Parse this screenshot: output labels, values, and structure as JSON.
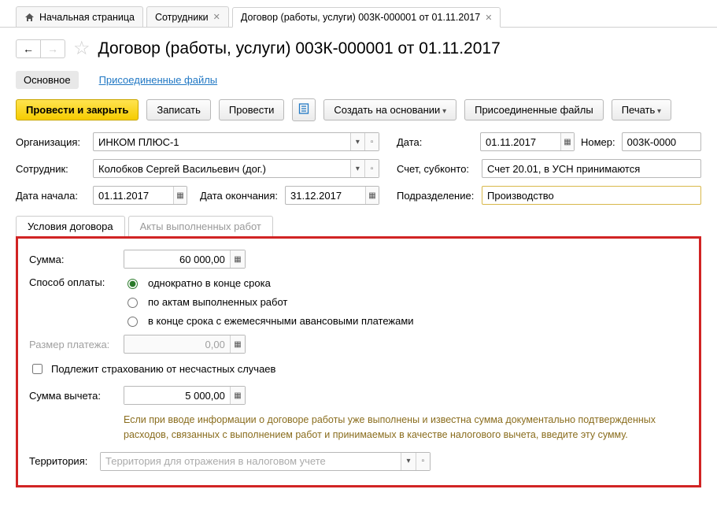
{
  "tabs": {
    "home": "Начальная страница",
    "emp": "Сотрудники",
    "doc": "Договор (работы, услуги) 003К-000001 от 01.11.2017"
  },
  "title": "Договор (работы, услуги) 003К-000001 от 01.11.2017",
  "section": {
    "main": "Основное",
    "files": "Присоединенные файлы"
  },
  "toolbar": {
    "post_close": "Провести и закрыть",
    "save": "Записать",
    "post": "Провести",
    "create_based": "Создать на основании",
    "attached": "Присоединенные файлы",
    "print": "Печать"
  },
  "fields": {
    "org_label": "Организация:",
    "org_value": "ИНКОМ ПЛЮС-1",
    "date_label": "Дата:",
    "date_value": "01.11.2017",
    "number_label": "Номер:",
    "number_value": "003К-0000",
    "employee_label": "Сотрудник:",
    "employee_value": "Колобков Сергей Васильевич (дог.)",
    "account_label": "Счет, субконто:",
    "account_value": "Счет 20.01, в УСН принимаются",
    "start_label": "Дата начала:",
    "start_value": "01.11.2017",
    "end_label": "Дата окончания:",
    "end_value": "31.12.2017",
    "dept_label": "Подразделение:",
    "dept_value": "Производство"
  },
  "inner_tabs": {
    "terms": "Условия договора",
    "acts": "Акты выполненных работ"
  },
  "panel": {
    "sum_label": "Сумма:",
    "sum_value": "60 000,00",
    "pay_method_label": "Способ оплаты:",
    "pay_opt1": "однократно в конце срока",
    "pay_opt2": "по актам выполненных работ",
    "pay_opt3": "в конце срока с ежемесячными авансовыми платежами",
    "payment_size_label": "Размер платежа:",
    "payment_size_value": "0,00",
    "insurance_label": "Подлежит страхованию от несчастных случаев",
    "deduction_label": "Сумма вычета:",
    "deduction_value": "5 000,00",
    "help_text": "Если при вводе информации о договоре работы уже выполнены и известна сумма документально подтвержденных расходов, связанных с выполнением работ и принимаемых в качестве налогового вычета, введите эту сумму.",
    "territory_label": "Территория:",
    "territory_placeholder": "Территория для отражения в налоговом учете"
  }
}
